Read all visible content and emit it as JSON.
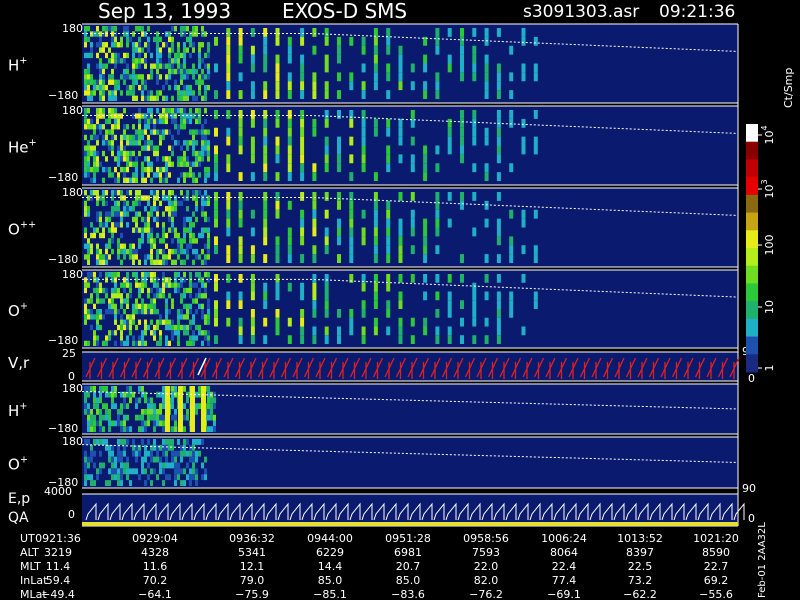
{
  "header": {
    "date": "Sep 13, 1993",
    "instrument": "EXOS-D SMS",
    "file": "s3091303.asr",
    "time": "09:21:36"
  },
  "colorbar": {
    "unit_label": "Ct/Smp",
    "tick_labels": [
      "1",
      "10",
      "100",
      "10",
      "10"
    ],
    "tick_exponents": [
      "",
      "",
      "",
      "3",
      "4"
    ],
    "colors": [
      "#1a2a80",
      "#1e50b0",
      "#1fb0c8",
      "#1fb06b",
      "#2bc83a",
      "#6fdc20",
      "#b4ec1c",
      "#e8ec16",
      "#c8a412",
      "#8a6a10",
      "#e60000",
      "#c00000",
      "#8a0000",
      "#ffffff"
    ]
  },
  "panels": [
    {
      "label": "H",
      "sup": "+",
      "ytop": "180",
      "ybot": "−180"
    },
    {
      "label": "He",
      "sup": "+",
      "ytop": "180",
      "ybot": "−180"
    },
    {
      "label": "O",
      "sup": "++",
      "ytop": "180",
      "ybot": "−180"
    },
    {
      "label": "O",
      "sup": "+",
      "ytop": "180",
      "ybot": "−180"
    }
  ],
  "vr_panel": {
    "label": "V,r",
    "ytop": "25",
    "ybot": "0",
    "right_top": "90",
    "right_bot": "0"
  },
  "lower_panels": [
    {
      "label": "H",
      "sup": "+",
      "ytop": "180",
      "ybot": "−180"
    },
    {
      "label": "O",
      "sup": "+",
      "ytop": "180",
      "ybot": "−180",
      "right": "90"
    }
  ],
  "ep_panel": {
    "label1": "E,p",
    "label2": "QA",
    "ytop": "4000",
    "ybot": "0",
    "right_bot": "0"
  },
  "side_note": "Feb-01 2AA32L",
  "chart_data": {
    "type": "heatmap",
    "title": "",
    "rows": [
      "UT",
      "ALT",
      "MLT",
      "InLat",
      "MLat"
    ],
    "columns": [
      "0921:36",
      "0929:04",
      "0936:32",
      "0944:00",
      "0951:28",
      "0958:56",
      "1006:24",
      "1013:52",
      "1021:20"
    ],
    "table": {
      "UT": [
        "0921:36",
        "0929:04",
        "0936:32",
        "0944:00",
        "0951:28",
        "0958:56",
        "1006:24",
        "1013:52",
        "1021:20"
      ],
      "ALT": [
        "3219",
        "4328",
        "5341",
        "6229",
        "6981",
        "7593",
        "8064",
        "8397",
        "8590"
      ],
      "MLT": [
        "11.4",
        "11.6",
        "12.1",
        "14.4",
        "20.7",
        "22.0",
        "22.4",
        "22.5",
        "22.7"
      ],
      "InLat": [
        "59.4",
        "70.2",
        "79.0",
        "85.0",
        "85.0",
        "82.0",
        "77.4",
        "73.2",
        "69.2"
      ],
      "MLat": [
        "−49.4",
        "−64.1",
        "−75.9",
        "−85.1",
        "−83.6",
        "−76.2",
        "−69.1",
        "−62.2",
        "−55.6"
      ]
    }
  }
}
